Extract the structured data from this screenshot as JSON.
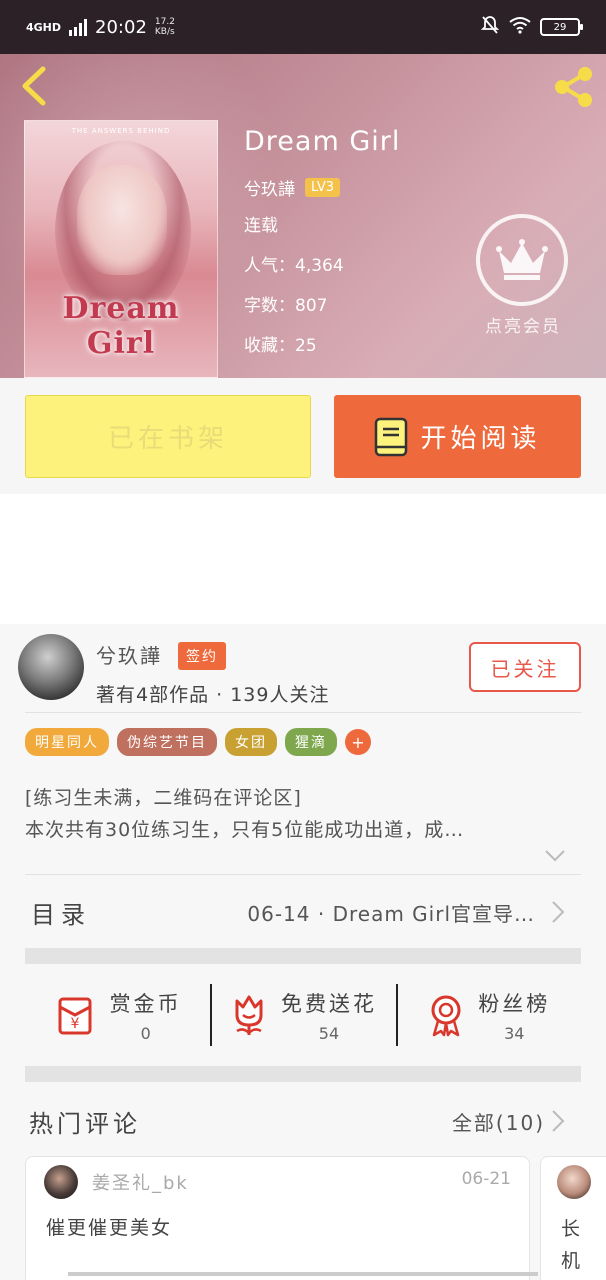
{
  "status_bar": {
    "network": "4GHD",
    "time": "20:02",
    "net_speed": "17.2",
    "net_unit": "KB/s",
    "battery": "29"
  },
  "book": {
    "title": "Dream Girl",
    "cover_title": "Dream Girl",
    "cover_top": "THE ANSWERS BEHIND",
    "author": "兮玖譁",
    "level": "LV3",
    "status": "连载",
    "popularity_label": "人气：",
    "popularity": "4,364",
    "words_label": "字数：",
    "words": "807",
    "favorites_label": "收藏：",
    "favorites": "25"
  },
  "vip": {
    "label": "点亮会员"
  },
  "actions": {
    "shelf_label": "已在书架",
    "read_label": "开始阅读"
  },
  "author_section": {
    "name": "兮玖譁",
    "signed": "签约",
    "stats": "著有4部作品 · 139人关注",
    "follow_label": "已关注"
  },
  "tags": [
    {
      "label": "明星同人",
      "color": "#f2a93b"
    },
    {
      "label": "伪综艺节目",
      "color": "#c0705f"
    },
    {
      "label": "女团",
      "color": "#c9a032"
    },
    {
      "label": "猩滴",
      "color": "#7fa84e"
    }
  ],
  "tag_add": "+",
  "description": {
    "line1": "[练习生未满，二维码在评论区]",
    "line2": "本次共有30位练习生，只有5位能成功出道，成…"
  },
  "toc": {
    "label": "目录",
    "latest": "06-14 · Dream Girl官宣导…"
  },
  "gifts": [
    {
      "label": "赏金币",
      "count": "0",
      "icon": "red-envelope-icon"
    },
    {
      "label": "免费送花",
      "count": "54",
      "icon": "flower-icon"
    },
    {
      "label": "粉丝榜",
      "count": "34",
      "icon": "medal-icon"
    }
  ],
  "comments": {
    "title": "热门评论",
    "all_label": "全部(10)",
    "items": [
      {
        "user": "姜圣礼_bk",
        "date": "06-21",
        "text": "催更催更美女"
      },
      {
        "text": "长机"
      }
    ]
  },
  "colors": {
    "accent": "#ee6a3c",
    "shelf_yellow": "#fdf27c",
    "follow_red": "#e8584a"
  }
}
